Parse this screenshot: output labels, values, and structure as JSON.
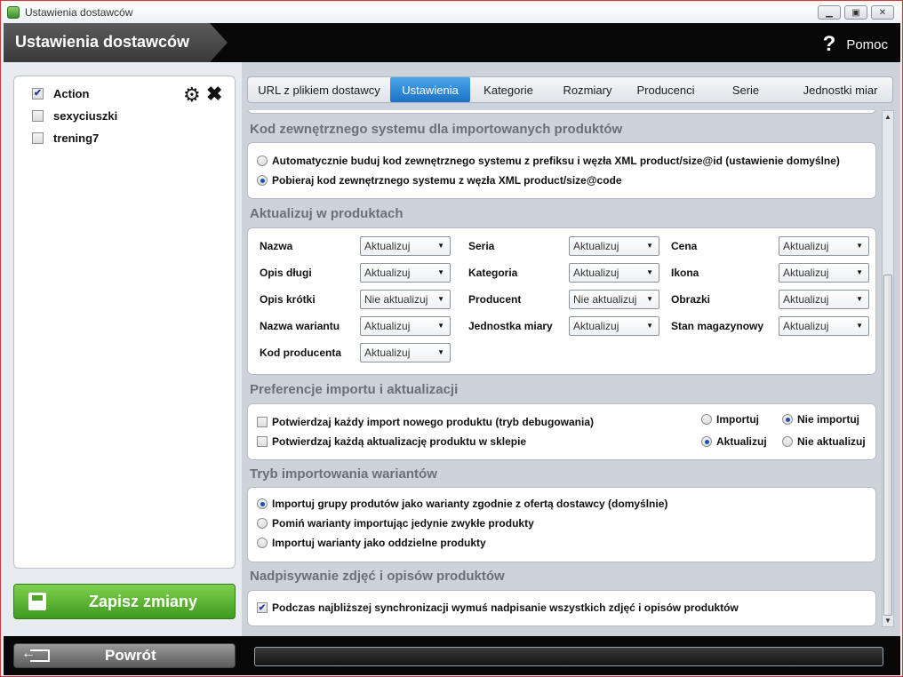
{
  "window": {
    "title": "Ustawienia dostawców"
  },
  "header": {
    "title": "Ustawienia dostawców",
    "help_label": "Pomoc"
  },
  "suppliers": [
    {
      "name": "Action",
      "checked": true
    },
    {
      "name": "sexyciuszki",
      "checked": false
    },
    {
      "name": "trening7",
      "checked": false
    }
  ],
  "save_label": "Zapisz zmiany",
  "back_label": "Powrót",
  "tabs": [
    "URL z plikiem dostawcy",
    "Ustawienia",
    "Kategorie",
    "Rozmiary",
    "Producenci",
    "Serie",
    "Jednostki miar"
  ],
  "active_tab": "Ustawienia",
  "sections": {
    "external_code": {
      "title": "Kod zewnętrznego systemu dla importowanych produktów",
      "options": [
        "Automatycznie buduj kod zewnętrznego systemu z prefiksu i węzła XML product/size@id (ustawienie domyślne)",
        "Pobieraj kod zewnętrznego systemu z węzła XML product/size@code"
      ],
      "selected": 1
    },
    "update": {
      "title": "Aktualizuj w produktach",
      "fields": [
        {
          "label": "Nazwa",
          "value": "Aktualizuj"
        },
        {
          "label": "Seria",
          "value": "Aktualizuj"
        },
        {
          "label": "Cena",
          "value": "Aktualizuj"
        },
        {
          "label": "Opis długi",
          "value": "Aktualizuj"
        },
        {
          "label": "Kategoria",
          "value": "Aktualizuj"
        },
        {
          "label": "Ikona",
          "value": "Aktualizuj"
        },
        {
          "label": "Opis krótki",
          "value": "Nie aktualizuj"
        },
        {
          "label": "Producent",
          "value": "Nie aktualizuj"
        },
        {
          "label": "Obrazki",
          "value": "Aktualizuj"
        },
        {
          "label": "Nazwa wariantu",
          "value": "Aktualizuj"
        },
        {
          "label": "Jednostka miary",
          "value": "Aktualizuj"
        },
        {
          "label": "Stan magazynowy",
          "value": "Aktualizuj"
        },
        {
          "label": "Kod producenta",
          "value": "Aktualizuj"
        }
      ]
    },
    "preferences": {
      "title": "Preferencje importu i aktualizacji",
      "confirm_import": "Potwierdzaj każdy import nowego produktu (tryb debugowania)",
      "confirm_update": "Potwierdzaj każdą aktualizację produktu w sklepie",
      "import": "Importuj",
      "no_import": "Nie importuj",
      "update": "Aktualizuj",
      "no_update": "Nie aktualizuj"
    },
    "variants": {
      "title": "Tryb importowania wariantów",
      "options": [
        "Importuj grupy produtów jako warianty zgodnie z ofertą dostawcy (domyślnie)",
        "Pomiń warianty importując jedynie zwykłe produkty",
        "Importuj warianty jako oddzielne produkty"
      ],
      "selected": 0
    },
    "overwrite": {
      "title": "Nadpisywanie zdjęć i opisów produktów",
      "option": "Podczas najbliższej synchronizacji wymuś nadpisanie wszystkich zdjęć i opisów produktów",
      "checked": true
    }
  }
}
